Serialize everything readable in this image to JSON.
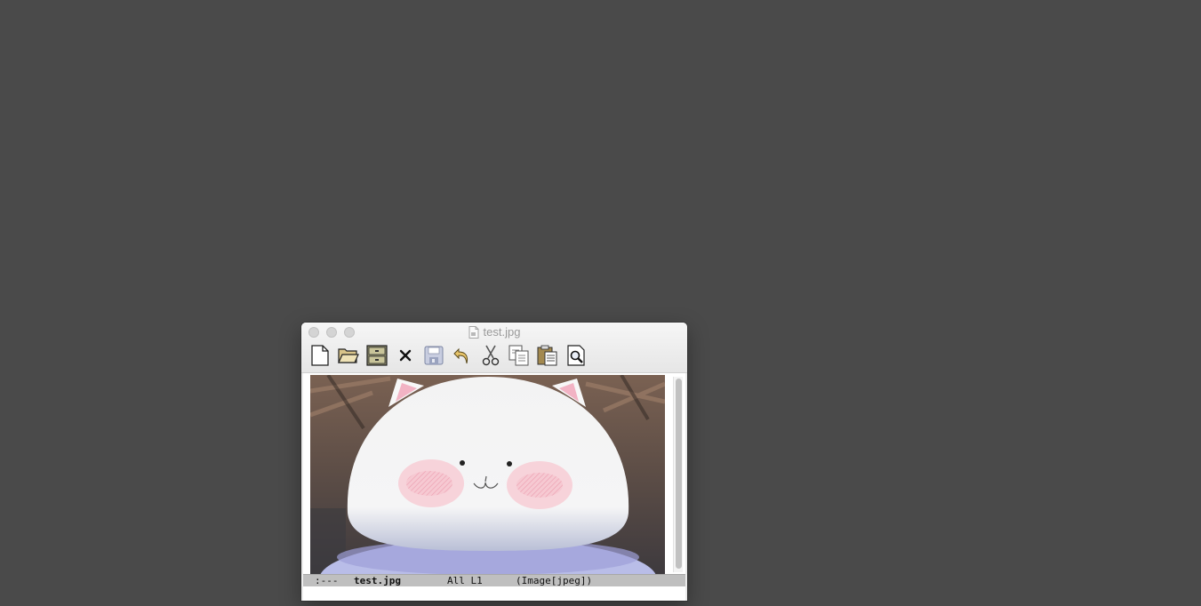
{
  "window": {
    "title": "test.jpg"
  },
  "toolbar": {
    "buttons": [
      {
        "name": "new-file",
        "icon": "new-file-icon"
      },
      {
        "name": "open-file",
        "icon": "open-folder-icon"
      },
      {
        "name": "dired",
        "icon": "file-cabinet-icon"
      },
      {
        "name": "kill-buffer",
        "icon": "close-x-icon"
      },
      {
        "name": "save",
        "icon": "floppy-disk-icon"
      },
      {
        "name": "undo",
        "icon": "undo-arrow-icon"
      },
      {
        "name": "cut",
        "icon": "scissors-icon"
      },
      {
        "name": "copy",
        "icon": "copy-icon"
      },
      {
        "name": "paste",
        "icon": "clipboard-icon"
      },
      {
        "name": "search",
        "icon": "magnifier-icon"
      }
    ]
  },
  "modeline": {
    "status": ":---",
    "buffer": "test.jpg",
    "position": "All L1",
    "mode": "(Image[jpeg])"
  },
  "colors": {
    "desktop": "#4a4a4a",
    "modeline": "#bfbfbf"
  }
}
